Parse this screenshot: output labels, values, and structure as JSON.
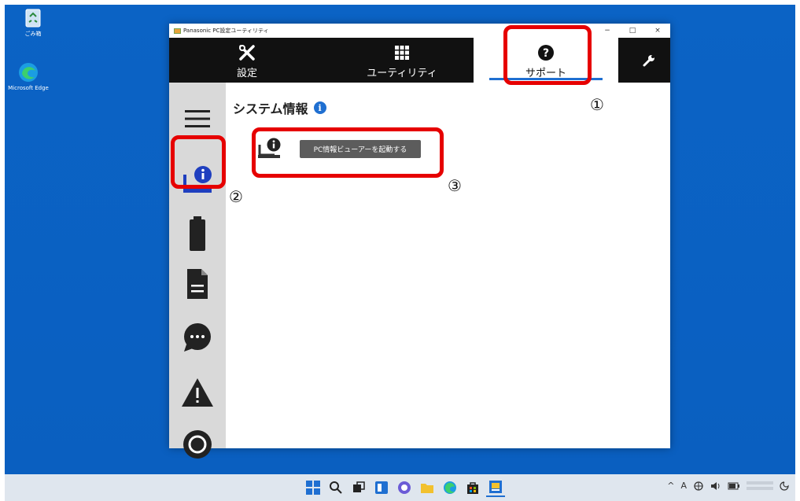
{
  "desktop": {
    "icons": [
      {
        "label": "ごみ箱",
        "icon": "recycle-bin-icon"
      },
      {
        "label": "Microsoft Edge",
        "icon": "edge-icon"
      }
    ]
  },
  "window": {
    "title": "Panasonic PC設定ユーティリティ",
    "controls": {
      "minimize": "−",
      "maximize": "□",
      "close": "×"
    }
  },
  "tabs": {
    "settings": {
      "label": "設定",
      "icon": "tools-icon"
    },
    "utility": {
      "label": "ユーティリティ",
      "icon": "grid-icon"
    },
    "support": {
      "label": "サポート",
      "icon": "question-icon",
      "selected": true
    },
    "tools": {
      "icon": "wrench-icon"
    }
  },
  "sidebar": {
    "items": [
      {
        "name": "menu",
        "icon": "hamburger-menu-icon"
      },
      {
        "name": "system-info",
        "icon": "laptop-info-icon",
        "selected": true
      },
      {
        "name": "battery",
        "icon": "battery-icon"
      },
      {
        "name": "document",
        "icon": "document-icon"
      },
      {
        "name": "chat",
        "icon": "chat-bubble-icon"
      },
      {
        "name": "warning",
        "icon": "warning-icon"
      },
      {
        "name": "record",
        "icon": "circle-target-icon"
      }
    ]
  },
  "main": {
    "title": "システム情報",
    "launch_button": "PC情報ビューアーを起動する"
  },
  "annotations": {
    "n1": "①",
    "n2": "②",
    "n3": "③",
    "color": "#e60000"
  },
  "taskbar": {
    "tray": {
      "chevron": "^",
      "ime": "A"
    }
  },
  "colors": {
    "accent": "#1f6fd1",
    "tabbar": "#111111",
    "sidebar": "#d9d9d9",
    "desktop": "#0a64c8"
  }
}
